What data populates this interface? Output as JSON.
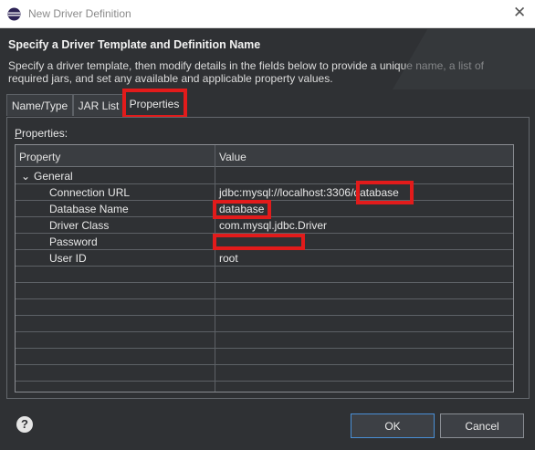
{
  "window": {
    "title": "New Driver Definition",
    "close_glyph": "✕"
  },
  "header": {
    "title": "Specify a Driver Template and Definition Name",
    "description": "Specify a driver template, then modify details in the fields below to provide a unique name, a list of required jars, and set any available and applicable property values."
  },
  "tabs": [
    {
      "label": "Name/Type"
    },
    {
      "label": "JAR List"
    },
    {
      "label": "Properties",
      "active": true
    }
  ],
  "properties_label": "Properties:",
  "table": {
    "columns": [
      "Property",
      "Value"
    ],
    "group": {
      "expander": "⌄",
      "label": "General"
    },
    "rows": [
      {
        "property": "Connection URL",
        "value": "jdbc:mysql://localhost:3306/database"
      },
      {
        "property": "Database Name",
        "value": "database"
      },
      {
        "property": "Driver Class",
        "value": "com.mysql.jdbc.Driver"
      },
      {
        "property": "Password",
        "value": ""
      },
      {
        "property": "User ID",
        "value": "root"
      }
    ]
  },
  "buttons": {
    "help": "?",
    "ok": "OK",
    "cancel": "Cancel"
  },
  "colors": {
    "highlight": "#e21b1b",
    "background": "#2f3134"
  }
}
